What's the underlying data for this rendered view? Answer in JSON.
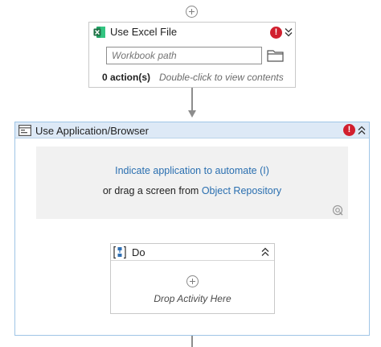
{
  "excel_scope": {
    "title": "Use Excel File",
    "error_icon": "!",
    "workbook_placeholder": "Workbook path",
    "actions_count": "0 action(s)",
    "actions_hint": "Double-click to view contents"
  },
  "app_scope": {
    "title": "Use Application/Browser",
    "error_icon": "!",
    "indicate_link": "Indicate application to automate (I)",
    "drag_prefix": "or drag a screen from",
    "object_repository": "Object Repository"
  },
  "do_block": {
    "title": "Do",
    "drop_text": "Drop Activity Here"
  },
  "colors": {
    "accent_blue": "#2a6fb0",
    "error_red": "#d11f2e",
    "excel_green": "#1e7145",
    "header_blue": "#dde9f6"
  }
}
